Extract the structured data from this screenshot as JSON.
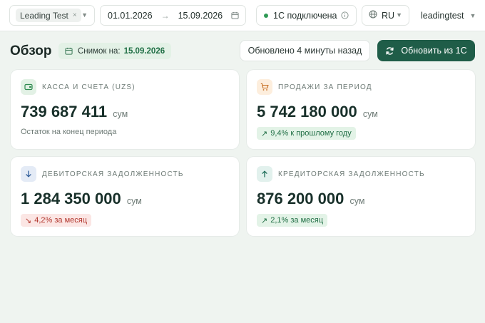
{
  "topbar": {
    "org_chip": "Leading Test",
    "org_chip_remove": "×",
    "date_from": "01.01.2026",
    "date_arrow": "→",
    "date_to": "15.09.2026",
    "status": "1С подключена",
    "status_color": "#2f9a55",
    "language": "RU",
    "user": "leadingtest"
  },
  "header": {
    "title": "Обзор",
    "snapshot_label": "Снимок на:",
    "snapshot_date": "15.09.2026",
    "updated": "Обновлено 4 минуты назад",
    "refresh_label": "Обновить из 1С"
  },
  "colors": {
    "accent": "#1f5d48",
    "positive": "#1f6e44",
    "negative": "#b1352c",
    "background": "#eff4f0"
  },
  "cards": [
    {
      "label": "КАССА И СЧЕТА",
      "label_suffix": " (UZS)",
      "icon": "wallet-icon",
      "value": "739 687 411",
      "unit": "сум",
      "sub": "Остаток на конец периода"
    },
    {
      "label": "ПРОДАЖИ ЗА ПЕРИОД",
      "icon": "cart-icon",
      "value": "5 742 180 000",
      "unit": "сум",
      "badge_arrow": "↗",
      "badge": "9,4% к прошлому году",
      "trend": "up"
    },
    {
      "label": "ДЕБИТОРСКАЯ ЗАДОЛЖЕННОСТЬ",
      "icon": "arrow-down-icon",
      "value": "1 284 350 000",
      "unit": "сум",
      "badge_arrow": "↘",
      "badge": "4,2% за месяц",
      "trend": "down"
    },
    {
      "label": "КРЕДИТОРСКАЯ ЗАДОЛЖЕННОСТЬ",
      "icon": "arrow-up-icon",
      "value": "876 200 000",
      "unit": "сум",
      "badge_arrow": "↗",
      "badge": "2,1% за месяц",
      "trend": "up"
    }
  ]
}
